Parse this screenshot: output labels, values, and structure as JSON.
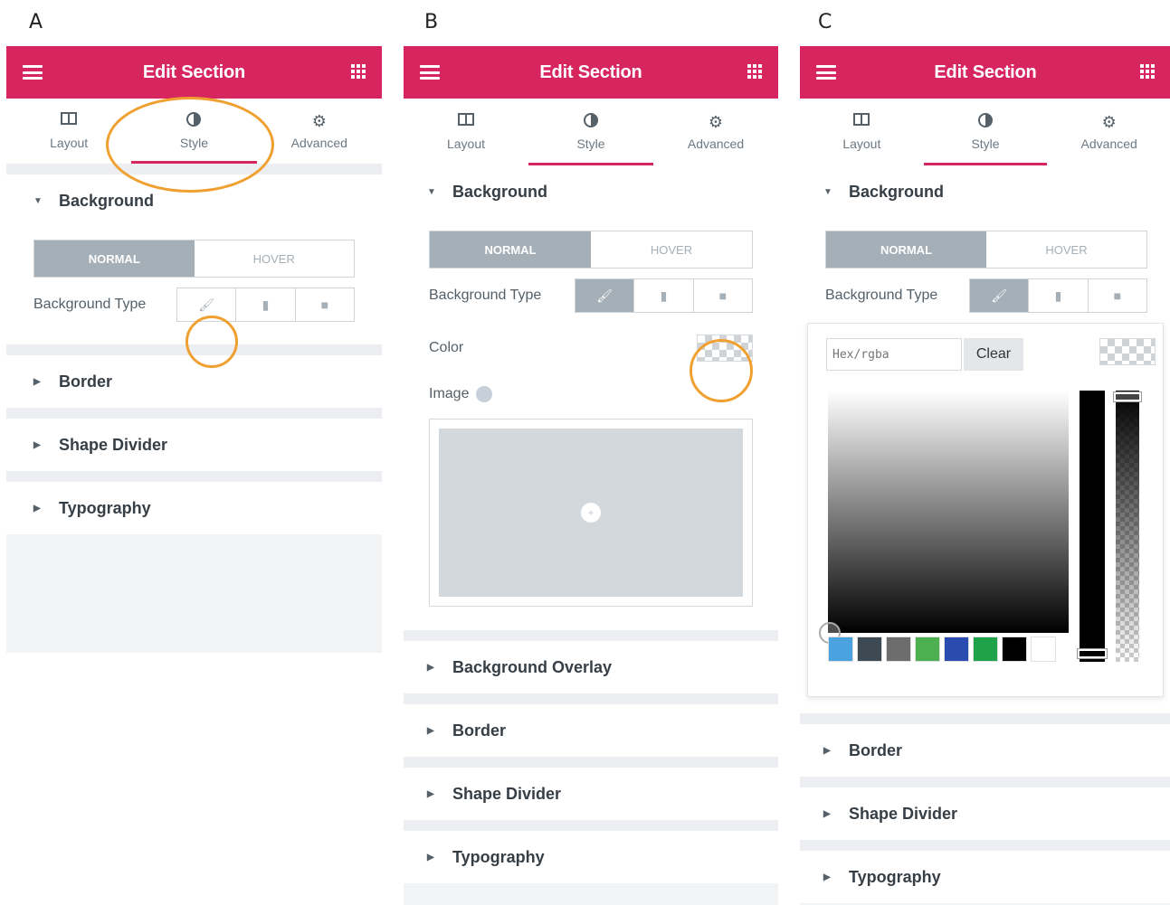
{
  "panel_labels": [
    "A",
    "B",
    "C"
  ],
  "header": {
    "title": "Edit Section"
  },
  "tabs": [
    "Layout",
    "Style",
    "Advanced"
  ],
  "sections": {
    "background": "Background",
    "background_overlay": "Background Overlay",
    "border": "Border",
    "shape_divider": "Shape Divider",
    "typography": "Typography"
  },
  "state_toggle": {
    "normal": "NORMAL",
    "hover": "HOVER"
  },
  "background_type_label": "Background Type",
  "color_label": "Color",
  "image_label": "Image",
  "picker": {
    "hex_placeholder": "Hex/rgba",
    "clear_label": "Clear"
  },
  "colors": {
    "accent": "#d6255f",
    "annotation": "#f0a030",
    "presets": [
      "#4aa3df",
      "#3d4a54",
      "#6d6d6d",
      "#4cb050",
      "#2a4cb0",
      "#1fa34a",
      "#000000",
      "#ffffff"
    ]
  }
}
